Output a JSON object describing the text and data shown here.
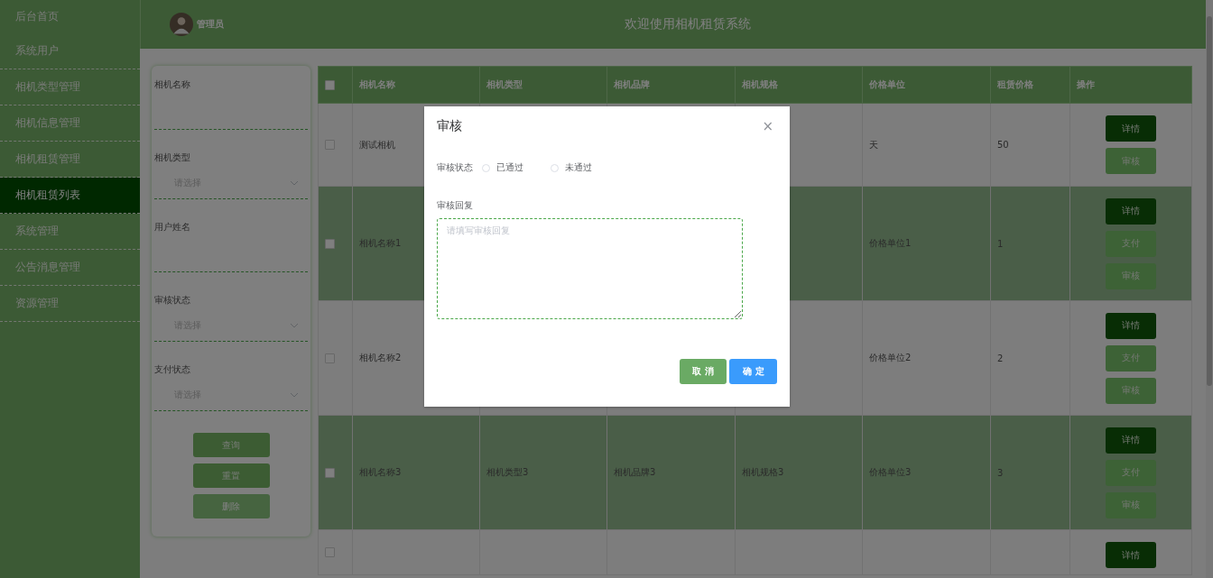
{
  "sidebar": {
    "items": [
      {
        "label": "后台首页",
        "selected": false
      },
      {
        "label": "系统用户",
        "selected": false
      },
      {
        "label": "相机类型管理",
        "selected": false
      },
      {
        "label": "相机信息管理",
        "selected": false
      },
      {
        "label": "相机租赁管理",
        "selected": false
      },
      {
        "label": "相机租赁列表",
        "selected": true
      },
      {
        "label": "系统管理",
        "selected": false
      },
      {
        "label": "公告消息管理",
        "selected": false
      },
      {
        "label": "资源管理",
        "selected": false
      }
    ]
  },
  "header": {
    "user": "管理员",
    "title": "欢迎使用相机租赁系统"
  },
  "search_panel": {
    "fields": [
      {
        "label": "相机名称",
        "kind": "input"
      },
      {
        "label": "相机类型",
        "kind": "select",
        "placeholder": "请选择"
      },
      {
        "label": "用户姓名",
        "kind": "input"
      },
      {
        "label": "审核状态",
        "kind": "select",
        "placeholder": "请选择"
      },
      {
        "label": "支付状态",
        "kind": "select",
        "placeholder": "请选择"
      }
    ],
    "buttons": [
      {
        "label": "查询",
        "disabled": false
      },
      {
        "label": "重置",
        "disabled": false
      },
      {
        "label": "删除",
        "disabled": true
      }
    ]
  },
  "table": {
    "select_all_checked": false,
    "columns": [
      "相机名称",
      "相机类型",
      "相机品牌",
      "相机规格",
      "价格单位",
      "租赁价格",
      "操作"
    ],
    "rows": [
      {
        "checked": false,
        "name": "测试相机",
        "unit": "天",
        "price": "50",
        "actions": [
          {
            "label": "详情",
            "kind": "detail"
          },
          {
            "label": "审核",
            "kind": "review"
          }
        ]
      },
      {
        "checked": false,
        "name": "相机名称1",
        "unit": "价格单位1",
        "price": "1",
        "actions": [
          {
            "label": "详情",
            "kind": "detail"
          },
          {
            "label": "支付",
            "kind": "pay"
          },
          {
            "label": "审核",
            "kind": "review"
          }
        ]
      },
      {
        "checked": false,
        "name": "相机名称2",
        "unit": "价格单位2",
        "price": "2",
        "actions": [
          {
            "label": "详情",
            "kind": "detail"
          },
          {
            "label": "支付",
            "kind": "pay"
          },
          {
            "label": "审核",
            "kind": "review"
          }
        ]
      },
      {
        "checked": false,
        "name": "相机名称3",
        "type": "相机类型3",
        "brand": "相机品牌3",
        "spec": "相机规格3",
        "unit": "价格单位3",
        "price": "3",
        "actions": [
          {
            "label": "详情",
            "kind": "detail"
          },
          {
            "label": "支付",
            "kind": "pay"
          },
          {
            "label": "审核",
            "kind": "review"
          }
        ]
      },
      {
        "checked": false,
        "actions": [
          {
            "label": "详情",
            "kind": "detail"
          }
        ]
      }
    ]
  },
  "dialog": {
    "title": "审核",
    "close": "×",
    "status_label": "审核状态",
    "options": [
      {
        "label": "已通过",
        "selected": false
      },
      {
        "label": "未通过",
        "selected": false
      }
    ],
    "reply_label": "审核回复",
    "reply_placeholder": "请填写审核回复",
    "buttons": [
      {
        "label": "取消",
        "kind": "cancel"
      },
      {
        "label": "确定",
        "kind": "confirm"
      }
    ]
  }
}
